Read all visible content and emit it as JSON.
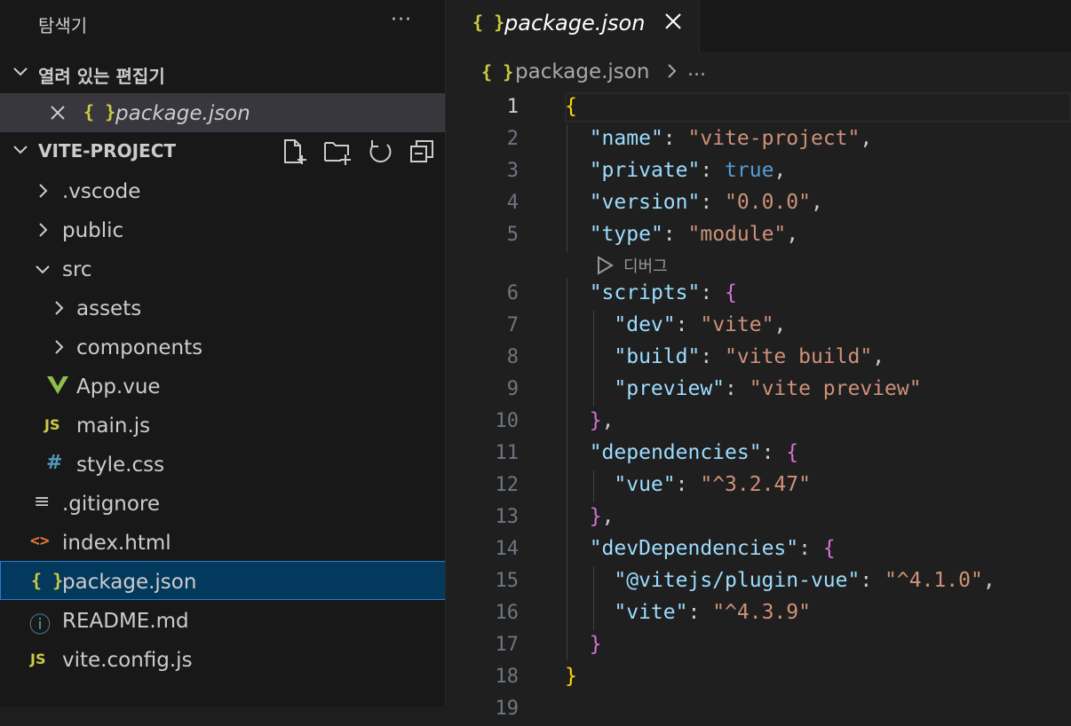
{
  "explorer": {
    "title": "탐색기",
    "more": "···",
    "open_editors": {
      "label": "열려 있는 편집기",
      "items": [
        {
          "icon": "json-braces-icon",
          "glyph": "{ }",
          "name": "package.json"
        }
      ]
    },
    "project": {
      "label": "VITE-PROJECT",
      "actions": [
        "new-file-icon",
        "new-folder-icon",
        "refresh-icon",
        "collapse-all-icon"
      ],
      "tree": [
        {
          "name": ".vscode",
          "kind": "folder",
          "expanded": false
        },
        {
          "name": "public",
          "kind": "folder",
          "expanded": false
        },
        {
          "name": "src",
          "kind": "folder",
          "expanded": true
        },
        {
          "name": "assets",
          "kind": "folder",
          "expanded": false
        },
        {
          "name": "components",
          "kind": "folder",
          "expanded": false
        },
        {
          "name": "App.vue",
          "kind": "file",
          "glyph": "V"
        },
        {
          "name": "main.js",
          "kind": "file",
          "glyph": "JS"
        },
        {
          "name": "style.css",
          "kind": "file",
          "glyph": "#"
        },
        {
          "name": ".gitignore",
          "kind": "file",
          "glyph": "≡"
        },
        {
          "name": "index.html",
          "kind": "file",
          "glyph": "<>"
        },
        {
          "name": "package.json",
          "kind": "file",
          "glyph": "{ }",
          "selected": true
        },
        {
          "name": "README.md",
          "kind": "file",
          "glyph": "ⓘ"
        },
        {
          "name": "vite.config.js",
          "kind": "file",
          "glyph": "JS"
        }
      ]
    }
  },
  "editor": {
    "tab": {
      "glyph": "{ }",
      "name": "package.json"
    },
    "breadcrumb": {
      "glyph": "{ }",
      "file": "package.json",
      "ellipsis": "..."
    },
    "codelens": "디버그",
    "line_numbers": [
      "1",
      "2",
      "3",
      "4",
      "5",
      "6",
      "7",
      "8",
      "9",
      "10",
      "11",
      "12",
      "13",
      "14",
      "15",
      "16",
      "17",
      "18",
      "19"
    ],
    "code": {
      "l2_key": "\"name\"",
      "l2_val": "\"vite-project\"",
      "l3_key": "\"private\"",
      "l3_val": "true",
      "l4_key": "\"version\"",
      "l4_val": "\"0.0.0\"",
      "l5_key": "\"type\"",
      "l5_val": "\"module\"",
      "l6_key": "\"scripts\"",
      "l7_key": "\"dev\"",
      "l7_val": "\"vite\"",
      "l8_key": "\"build\"",
      "l8_val": "\"vite build\"",
      "l9_key": "\"preview\"",
      "l9_val": "\"vite preview\"",
      "l11_key": "\"dependencies\"",
      "l12_key": "\"vue\"",
      "l12_val": "\"^3.2.47\"",
      "l14_key": "\"devDependencies\"",
      "l15_key": "\"@vitejs/plugin-vue\"",
      "l15_val": "\"^4.1.0\"",
      "l16_key": "\"vite\"",
      "l16_val": "\"^4.3.9\""
    }
  },
  "colors": {
    "json_icon": "#cbcb41",
    "js_icon": "#cbcb41",
    "vue_icon": "#8dc149",
    "css_icon": "#519aba",
    "html_icon": "#e37933",
    "info_icon": "#519aba",
    "selection": "#04395e"
  }
}
